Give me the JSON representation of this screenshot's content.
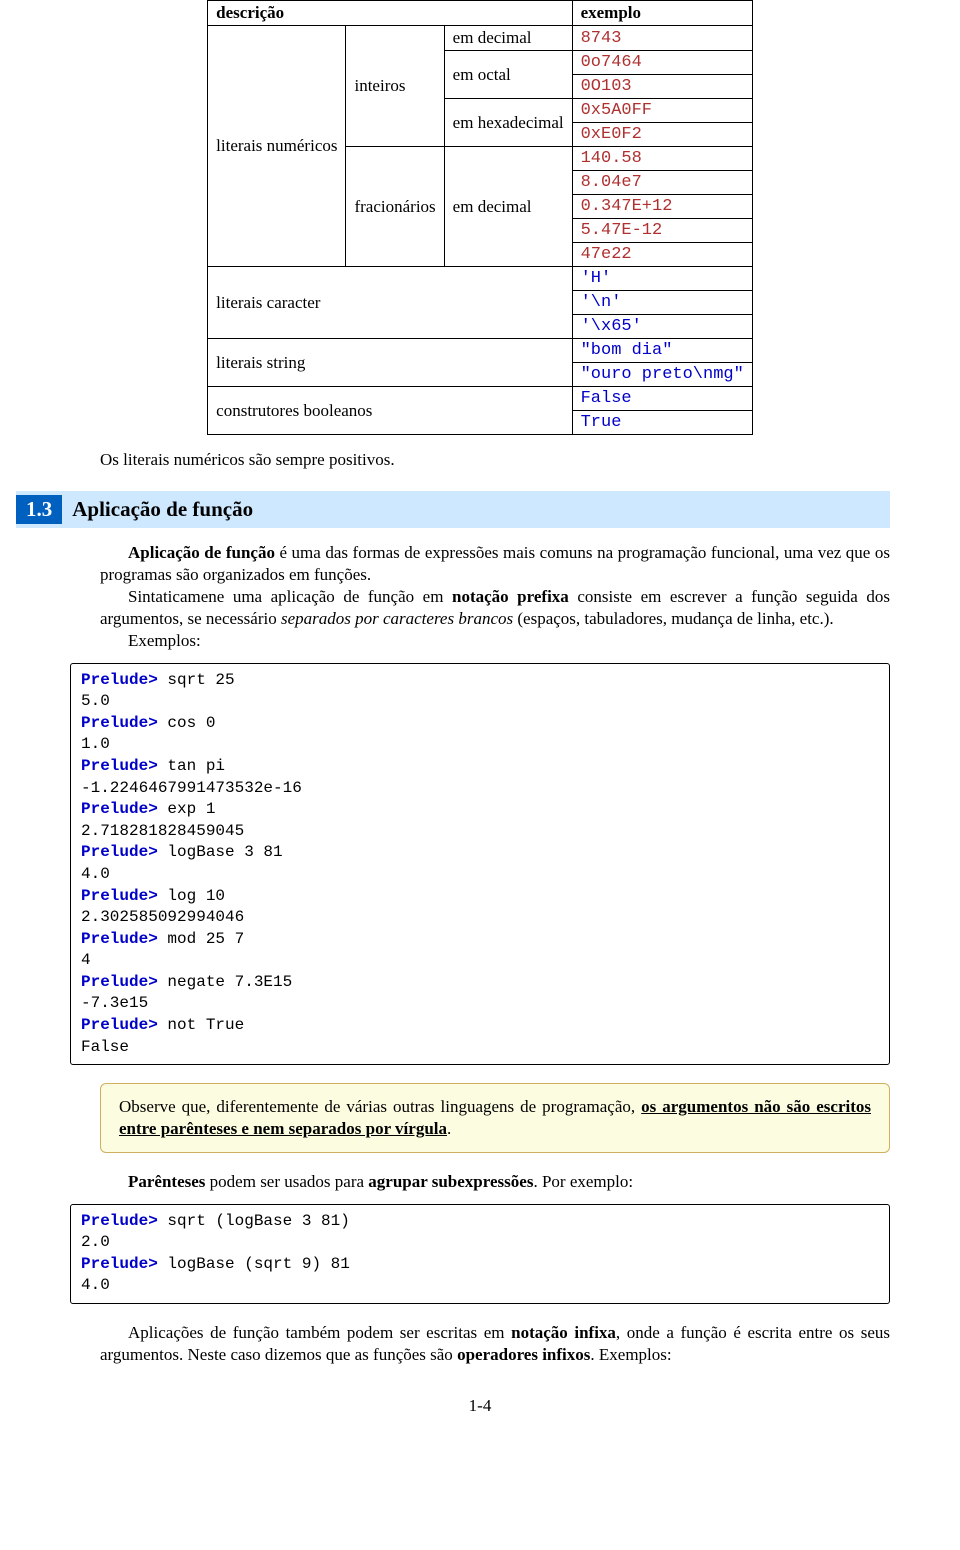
{
  "table": {
    "headers": {
      "desc": "descrição",
      "example": "exemplo"
    },
    "rows": {
      "numeric_label": "literais numéricos",
      "int_label": "inteiros",
      "frac_label": "fracionários",
      "dec_label": "em decimal",
      "oct_label": "em octal",
      "hex_label": "em hexadecimal",
      "dec2_label": "em decimal",
      "ex_dec": "8743",
      "ex_oct1": "0o7464",
      "ex_oct2": "0O103",
      "ex_hex1": "0x5A0FF",
      "ex_hex2": "0xE0F2",
      "ex_f1": "140.58",
      "ex_f2": "8.04e7",
      "ex_f3": "0.347E+12",
      "ex_f4": "5.47E-12",
      "ex_f5": "47e22",
      "char_label": "literais caracter",
      "ex_c1": "'H'",
      "ex_c2": "'\\n'",
      "ex_c3": "'\\x65'",
      "str_label": "literais string",
      "ex_s1": "\"bom dia\"",
      "ex_s2": "\"ouro preto\\nmg\"",
      "bool_label": "construtores booleanos",
      "ex_b1": "False",
      "ex_b2": "True"
    }
  },
  "text": {
    "after_table": "Os literais numéricos são sempre positivos.",
    "section_num": "1.3",
    "section_title": "Aplicação de função",
    "p1a": "Aplicação de função",
    "p1b": " é uma das formas de expressões mais comuns na programação funcional, uma vez que os programas são organizados em funções.",
    "p2a": "Sintaticamene uma aplicação de função em ",
    "p2b": "notação prefixa",
    "p2c": " consiste em escrever a função seguida dos argumentos, se necessário ",
    "p2d": "separados por caracteres brancos",
    "p2e": " (espaços, tabuladores, mudança de linha, etc.).",
    "p3": "Exemplos:",
    "note_a": "Observe que, diferentemente de várias outras linguagens de programação, ",
    "note_b": "os argumentos não são escritos entre parênteses e nem separados por vírgula",
    "note_c": ".",
    "p4a": "Parênteses",
    "p4b": " podem ser usados para ",
    "p4c": "agrupar subexpressões",
    "p4d": ". Por exemplo:",
    "p5a": "Aplicações de função também podem ser escritas em ",
    "p5b": "notação infixa",
    "p5c": ", onde a função é escrita entre os seus argumentos. Neste caso dizemos que as funções são ",
    "p5d": "operadores infixos",
    "p5e": ". Exemplos:",
    "page_num": "1-4"
  },
  "code1": {
    "prompt": "Prelude>",
    "l1": " sqrt 25",
    "o1": "5.0",
    "l2": " cos 0",
    "o2": "1.0",
    "l3": " tan pi",
    "o3": "-1.2246467991473532e-16",
    "l4": " exp 1",
    "o4": "2.718281828459045",
    "l5": " logBase 3 81",
    "o5": "4.0",
    "l6": " log 10",
    "o6": "2.302585092994046",
    "l7": " mod 25 7",
    "o7": "4",
    "l8": " negate 7.3E15",
    "o8": "-7.3e15",
    "l9": " not True",
    "o9": "False"
  },
  "code2": {
    "prompt": "Prelude>",
    "l1": " sqrt (logBase 3 81)",
    "o1": "2.0",
    "l2": " logBase (sqrt 9) 81",
    "o2": "4.0"
  }
}
